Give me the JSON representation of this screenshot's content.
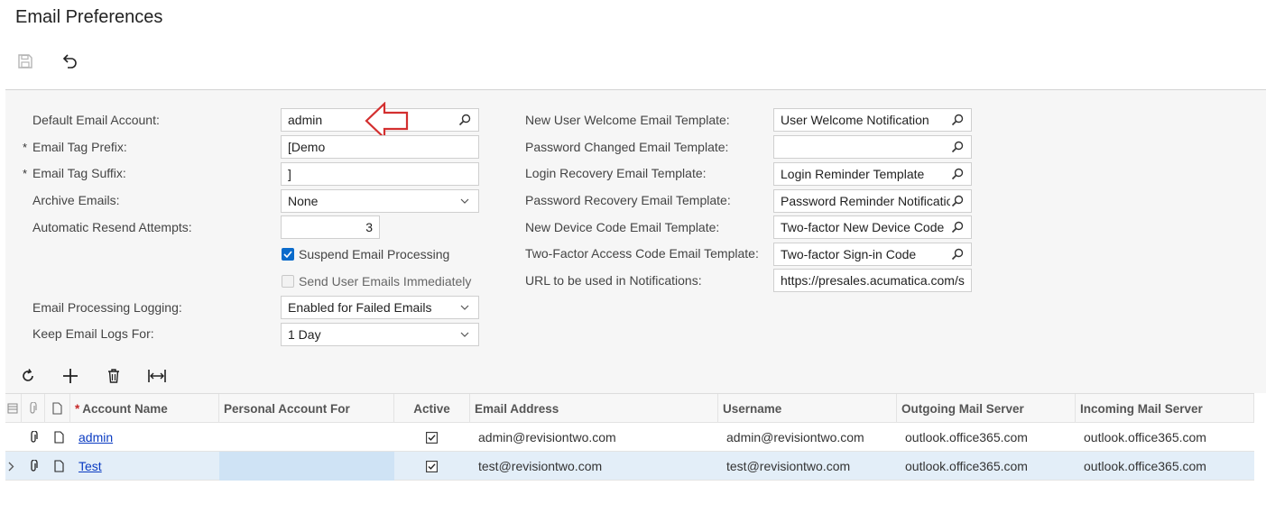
{
  "page": {
    "title": "Email Preferences"
  },
  "toolbar": {
    "save_icon": "save-icon",
    "undo_icon": "undo-icon"
  },
  "form": {
    "left": [
      {
        "label": "Default Email Account:",
        "value": "admin",
        "required": false,
        "kind": "lookup"
      },
      {
        "label": "Email Tag Prefix:",
        "value": "[Demo",
        "required": true,
        "kind": "text"
      },
      {
        "label": "Email Tag Suffix:",
        "value": "]",
        "required": true,
        "kind": "text"
      },
      {
        "label": "Archive Emails:",
        "value": "None",
        "required": false,
        "kind": "select"
      },
      {
        "label": "Automatic Resend Attempts:",
        "value": "3",
        "required": false,
        "kind": "number"
      },
      {
        "label": "Email Processing Logging:",
        "value": "Enabled for Failed Emails",
        "required": false,
        "kind": "select"
      },
      {
        "label": "Keep Email Logs For:",
        "value": "1 Day",
        "required": false,
        "kind": "select"
      }
    ],
    "checkboxes": [
      {
        "label": "Suspend Email Processing",
        "checked": true,
        "enabled": true
      },
      {
        "label": "Send User Emails Immediately",
        "checked": false,
        "enabled": false
      }
    ],
    "right": [
      {
        "label": "New User Welcome Email Template:",
        "value": "User Welcome Notification",
        "kind": "lookup"
      },
      {
        "label": "Password Changed Email Template:",
        "value": "",
        "kind": "lookup"
      },
      {
        "label": "Login Recovery Email Template:",
        "value": "Login Reminder Template",
        "kind": "lookup"
      },
      {
        "label": "Password Recovery Email Template:",
        "value": "Password Reminder Notification",
        "kind": "lookup"
      },
      {
        "label": "New Device Code Email Template:",
        "value": "Two-factor New Device Code",
        "kind": "lookup"
      },
      {
        "label": "Two-Factor Access Code Email Template:",
        "value": "Two-factor Sign-in Code",
        "kind": "lookup"
      },
      {
        "label": "URL to be used in Notifications:",
        "value": "https://presales.acumatica.com/s",
        "kind": "text"
      }
    ]
  },
  "grid_toolbar": {
    "icons": [
      "refresh-icon",
      "add-icon",
      "delete-icon",
      "fit-columns-icon"
    ]
  },
  "grid": {
    "columns": [
      "Account Name",
      "Personal Account For",
      "Active",
      "Email Address",
      "Username",
      "Outgoing Mail Server",
      "Incoming Mail Server"
    ],
    "rows": [
      {
        "account_name": "admin",
        "personal_account_for": "",
        "active": true,
        "email": "admin@revisiontwo.com",
        "username": "admin@revisiontwo.com",
        "outgoing": "outlook.office365.com",
        "incoming": "outlook.office365.com",
        "selected": false
      },
      {
        "account_name": "Test",
        "personal_account_for": "",
        "active": true,
        "email": "test@revisiontwo.com",
        "username": "test@revisiontwo.com",
        "outgoing": "outlook.office365.com",
        "incoming": "outlook.office365.com",
        "selected": true
      }
    ]
  },
  "colors": {
    "accent": "#0b6bcb",
    "link": "#0a3bc2",
    "callout_arrow": "#d32f2f",
    "selected_row": "#e3eef8"
  }
}
